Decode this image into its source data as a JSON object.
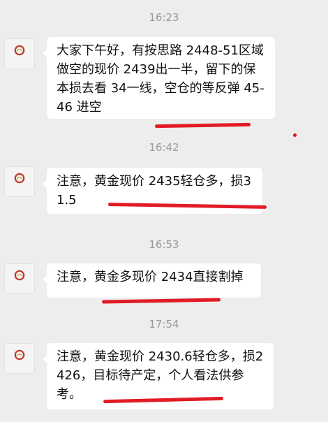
{
  "colors": {
    "background": "#ededed",
    "bubble": "#ffffff",
    "text": "#111111",
    "timestamp": "#9a9a9a",
    "annotation": "#e0101a",
    "avatar_accent": "#c0392b"
  },
  "avatar_icon": "red-circle-logo-icon",
  "messages": [
    {
      "time": "16:23",
      "text": "大家下午好，有按思路 2448-51区域做空的现价 2439出一半，留下的保本损去看 34一线，空仓的等反弹 45-46 进空"
    },
    {
      "time": "16:42",
      "text": "注意，黄金现价 2435轻仓多，损31.5"
    },
    {
      "time": "16:53",
      "text": "注意，黄金多现价 2434直接割掉"
    },
    {
      "time": "17:54",
      "text": "注意，黄金现价 2430.6轻仓多，损2426，目标待产定，个人看法供参考。"
    }
  ]
}
